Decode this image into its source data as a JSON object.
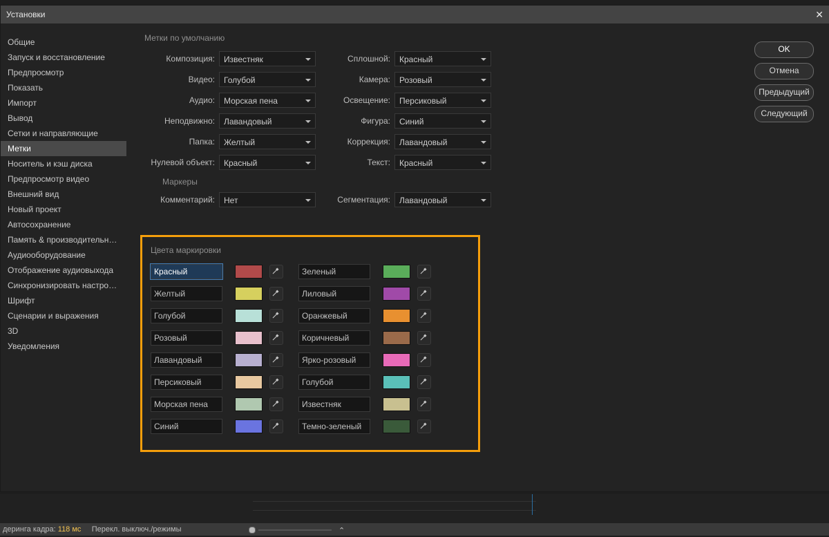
{
  "window": {
    "title": "Установки"
  },
  "buttons": {
    "ok": "OK",
    "cancel": "Отмена",
    "prev": "Предыдущий",
    "next": "Следующий"
  },
  "sidebar": {
    "items": [
      "Общие",
      "Запуск и восстановление",
      "Предпросмотр",
      "Показать",
      "Импорт",
      "Вывод",
      "Сетки и направляющие",
      "Метки",
      "Носитель и кэш диска",
      "Предпросмотр видео",
      "Внешний вид",
      "Новый проект",
      "Автосохранение",
      "Память & производительность",
      "Аудиооборудование",
      "Отображение аудиовыхода",
      "Синхронизировать настройки",
      "Шрифт",
      "Сценарии и выражения",
      "3D",
      "Уведомления"
    ],
    "selected": 7
  },
  "defaults": {
    "section": "Метки по умолчанию",
    "left": [
      {
        "label": "Композиция:",
        "value": "Известняк"
      },
      {
        "label": "Видео:",
        "value": "Голубой"
      },
      {
        "label": "Аудио:",
        "value": "Морская пена"
      },
      {
        "label": "Неподвижно:",
        "value": "Лавандовый"
      },
      {
        "label": "Папка:",
        "value": "Желтый"
      },
      {
        "label": "Нулевой объект:",
        "value": "Красный"
      }
    ],
    "right": [
      {
        "label": "Сплошной:",
        "value": "Красный"
      },
      {
        "label": "Камера:",
        "value": "Розовый"
      },
      {
        "label": "Освещение:",
        "value": "Персиковый"
      },
      {
        "label": "Фигура:",
        "value": "Синий"
      },
      {
        "label": "Коррекция:",
        "value": "Лавандовый"
      },
      {
        "label": "Текст:",
        "value": "Красный"
      }
    ]
  },
  "markers": {
    "section": "Маркеры",
    "comment_label": "Комментарий:",
    "comment_value": "Нет",
    "seg_label": "Сегментация:",
    "seg_value": "Лавандовый"
  },
  "colors": {
    "section": "Цвета маркировки",
    "left": [
      {
        "name": "Красный",
        "hex": "#b14a4a",
        "selected": true
      },
      {
        "name": "Желтый",
        "hex": "#d6d05e"
      },
      {
        "name": "Голубой",
        "hex": "#b8e0d8"
      },
      {
        "name": "Розовый",
        "hex": "#e8c0cc"
      },
      {
        "name": "Лавандовый",
        "hex": "#b8b0d0"
      },
      {
        "name": "Персиковый",
        "hex": "#e8c8a0"
      },
      {
        "name": "Морская пена",
        "hex": "#b0c8b0"
      },
      {
        "name": "Синий",
        "hex": "#6a74e0"
      }
    ],
    "right": [
      {
        "name": "Зеленый",
        "hex": "#5aad5a"
      },
      {
        "name": "Лиловый",
        "hex": "#a04aa8"
      },
      {
        "name": "Оранжевый",
        "hex": "#e89030"
      },
      {
        "name": "Коричневый",
        "hex": "#9a6a4a"
      },
      {
        "name": "Ярко-розовый",
        "hex": "#e86ab8"
      },
      {
        "name": "Голубой",
        "hex": "#5ac0b8"
      },
      {
        "name": "Известняк",
        "hex": "#c8c090"
      },
      {
        "name": "Темно-зеленый",
        "hex": "#3a5a3a"
      }
    ]
  },
  "status": {
    "render_label": "деринга кадра:",
    "render_value": "118 мс",
    "toggle": "Перекл. выключ./режимы"
  }
}
